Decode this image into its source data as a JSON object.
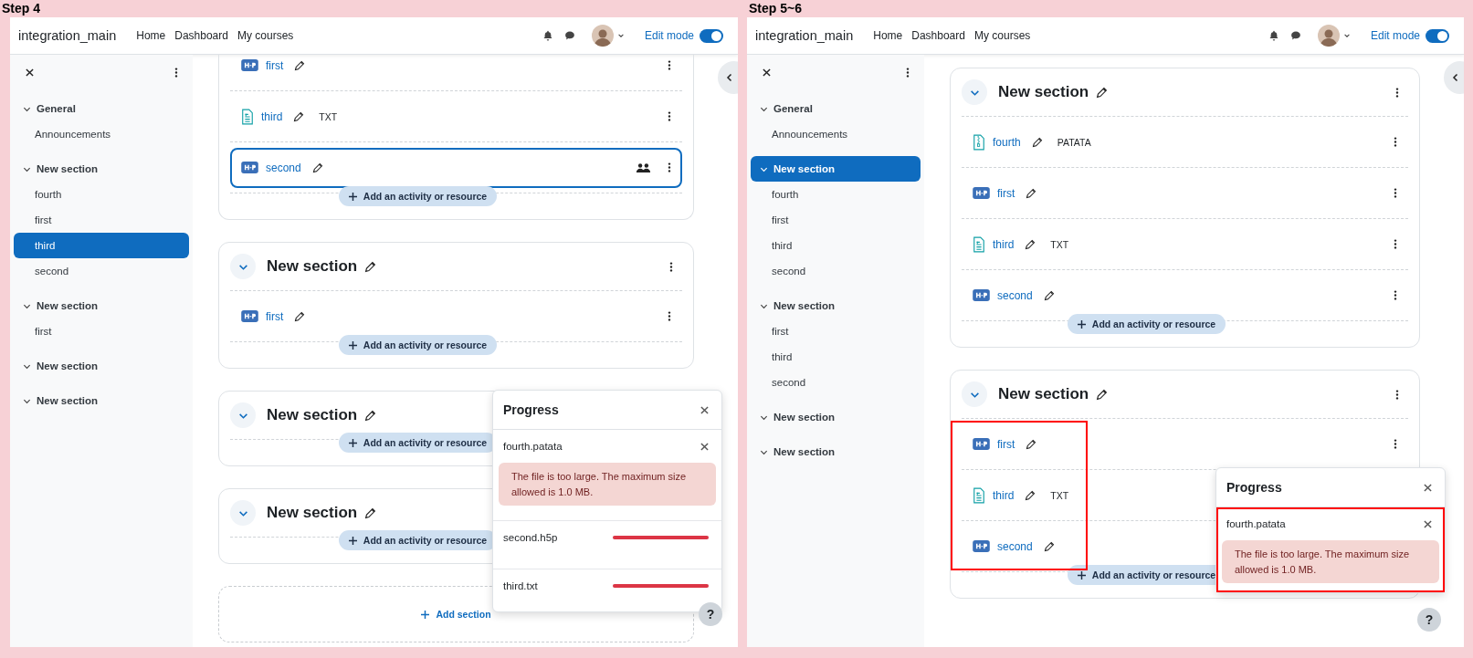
{
  "panels": [
    {
      "step_label": "Step 4",
      "navbar": {
        "site_name": "integration_main",
        "links": [
          "Home",
          "Dashboard",
          "My courses"
        ],
        "edit_mode": {
          "label": "Edit mode",
          "on": true
        }
      },
      "sidebar": {
        "sections": [
          {
            "title": "General",
            "expanded": true,
            "selected": false,
            "children": [
              {
                "title": "Announcements",
                "selected": false
              }
            ]
          },
          {
            "title": "New section",
            "expanded": true,
            "selected": false,
            "children": [
              {
                "title": "fourth",
                "selected": false
              },
              {
                "title": "first",
                "selected": false
              },
              {
                "title": "third",
                "selected": true
              },
              {
                "title": "second",
                "selected": false
              }
            ]
          },
          {
            "title": "New section",
            "expanded": true,
            "selected": false,
            "children": [
              {
                "title": "first",
                "selected": false
              }
            ]
          },
          {
            "title": "New section",
            "expanded": true,
            "selected": false
          },
          {
            "title": "New section",
            "expanded": true,
            "selected": false
          }
        ]
      },
      "cards": [
        {
          "activities": [
            {
              "kind": "h5p",
              "name": "first",
              "focused": false,
              "groups": false
            },
            {
              "kind": "text",
              "name": "third",
              "type_label": "TXT",
              "focused": false,
              "groups": false
            },
            {
              "kind": "h5p",
              "name": "second",
              "focused": true,
              "groups": true
            }
          ],
          "add_button": "Add an activity or resource",
          "rows_marked": false
        },
        {
          "title": "New section",
          "activities": [
            {
              "kind": "h5p",
              "name": "first",
              "focused": false
            }
          ],
          "add_button": "Add an activity or resource",
          "rows_marked": false
        },
        {
          "title": "New section",
          "add_button": "Add an activity or resource",
          "rows_marked": false
        },
        {
          "title": "New section",
          "add_button": "Add an activity or resource",
          "rows_marked": false
        }
      ],
      "add_section": "Add section",
      "progress": {
        "title": "Progress",
        "items": [
          {
            "kind": "error",
            "file": "fourth.patata",
            "message": "The file is too large. The maximum size allowed is 1.0 MB.",
            "marked": false
          },
          {
            "kind": "upload",
            "file": "second.h5p",
            "level": 1,
            "marked": false
          },
          {
            "kind": "upload",
            "file": "third.txt",
            "level": 1,
            "marked": false
          }
        ]
      },
      "help": "?"
    },
    {
      "step_label": "Step 5~6",
      "navbar": {
        "site_name": "integration_main",
        "links": [
          "Home",
          "Dashboard",
          "My courses"
        ],
        "edit_mode": {
          "label": "Edit mode",
          "on": true
        }
      },
      "sidebar": {
        "sections": [
          {
            "title": "General",
            "expanded": true,
            "selected": false,
            "children": [
              {
                "title": "Announcements",
                "selected": false
              }
            ]
          },
          {
            "title": "New section",
            "expanded": true,
            "selected": true,
            "children": [
              {
                "title": "fourth",
                "selected": false
              },
              {
                "title": "first",
                "selected": false
              },
              {
                "title": "third",
                "selected": false
              },
              {
                "title": "second",
                "selected": false
              }
            ]
          },
          {
            "title": "New section",
            "expanded": true,
            "selected": false,
            "children": [
              {
                "title": "first",
                "selected": false
              },
              {
                "title": "third",
                "selected": false
              },
              {
                "title": "second",
                "selected": false
              }
            ]
          },
          {
            "title": "New section",
            "expanded": true,
            "selected": false
          },
          {
            "title": "New section",
            "expanded": true,
            "selected": false
          }
        ]
      },
      "cards": [
        {
          "title": "New section",
          "activities": [
            {
              "kind": "file",
              "name": "fourth",
              "type_label": "PATATA",
              "focused": false
            },
            {
              "kind": "h5p",
              "name": "first",
              "focused": false
            },
            {
              "kind": "text",
              "name": "third",
              "type_label": "TXT",
              "focused": false
            },
            {
              "kind": "h5p",
              "name": "second",
              "focused": false
            }
          ],
          "add_button": "Add an activity or resource",
          "rows_marked": false
        },
        {
          "title": "New section",
          "activities": [
            {
              "kind": "h5p",
              "name": "first",
              "focused": false
            },
            {
              "kind": "text",
              "name": "third",
              "type_label": "TXT",
              "focused": false
            },
            {
              "kind": "h5p",
              "name": "second",
              "focused": false
            }
          ],
          "add_button": "Add an activity or resource",
          "rows_marked": true
        }
      ],
      "progress": {
        "title": "Progress",
        "items": [
          {
            "kind": "error",
            "file": "fourth.patata",
            "message": "The file is too large. The maximum size allowed is 1.0 MB.",
            "marked": true
          }
        ]
      },
      "help": "?"
    }
  ]
}
